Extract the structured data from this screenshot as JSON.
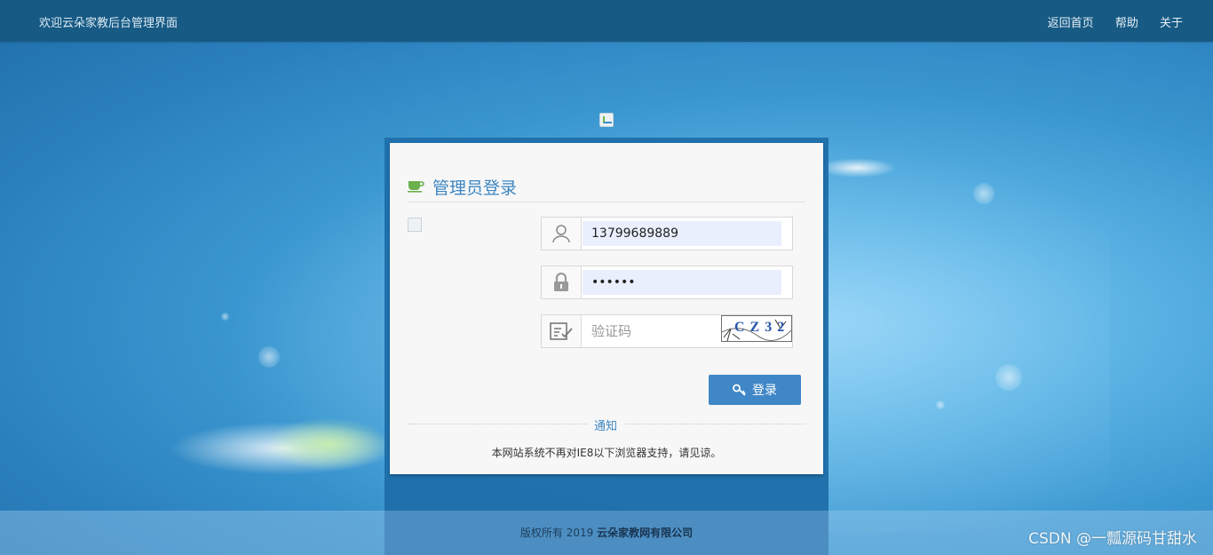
{
  "header": {
    "welcome": "欢迎云朵家教后台管理界面",
    "nav": [
      "返回首页",
      "帮助",
      "关于"
    ]
  },
  "login": {
    "title": "管理员登录",
    "username": "13799689889",
    "password": "••••••",
    "captcha_placeholder": "验证码",
    "captcha_text": "CZ32",
    "submit": "登录",
    "notice_label": "通知",
    "notice_text": "本网站系统不再对IE8以下浏览器支持，请见谅。"
  },
  "footer": {
    "prefix": "版权所有 2019",
    "company": "云朵家教网有限公司"
  },
  "watermark": "CSDN @一瓢源码甘甜水",
  "colors": {
    "accent": "#3f87c7",
    "topbar": "#175a84",
    "title": "#3c86c2"
  }
}
